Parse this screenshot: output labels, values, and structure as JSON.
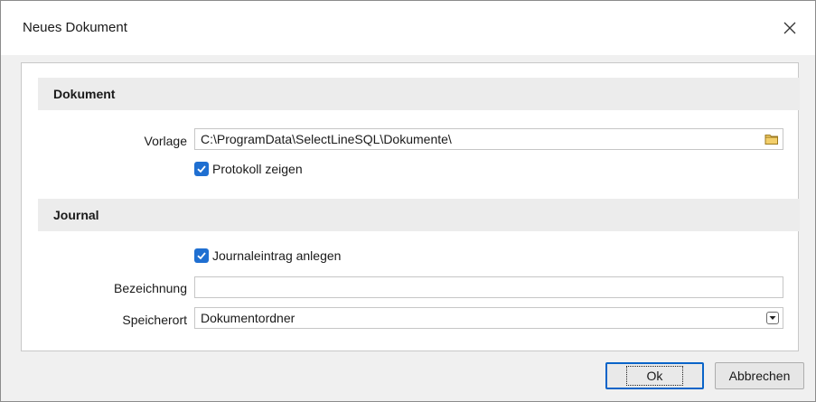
{
  "window": {
    "title": "Neues Dokument",
    "close_icon": "close-icon"
  },
  "sections": {
    "dokument": {
      "header": "Dokument",
      "vorlage_label": "Vorlage",
      "vorlage_value": "C:\\ProgramData\\SelectLineSQL\\Dokumente\\",
      "folder_icon": "folder-icon",
      "protokoll_label": "Protokoll zeigen",
      "protokoll_checked": true
    },
    "journal": {
      "header": "Journal",
      "journaleintrag_label": "Journaleintrag anlegen",
      "journaleintrag_checked": true,
      "bezeichnung_label": "Bezeichnung",
      "bezeichnung_value": "",
      "speicherort_label": "Speicherort",
      "speicherort_value": "Dokumentordner",
      "dropdown_icon": "chevron-down-icon"
    }
  },
  "buttons": {
    "ok": "Ok",
    "cancel": "Abbrechen"
  },
  "colors": {
    "accent": "#1f6fd1",
    "section_bg": "#ececec",
    "folder": "#e8b84a"
  }
}
